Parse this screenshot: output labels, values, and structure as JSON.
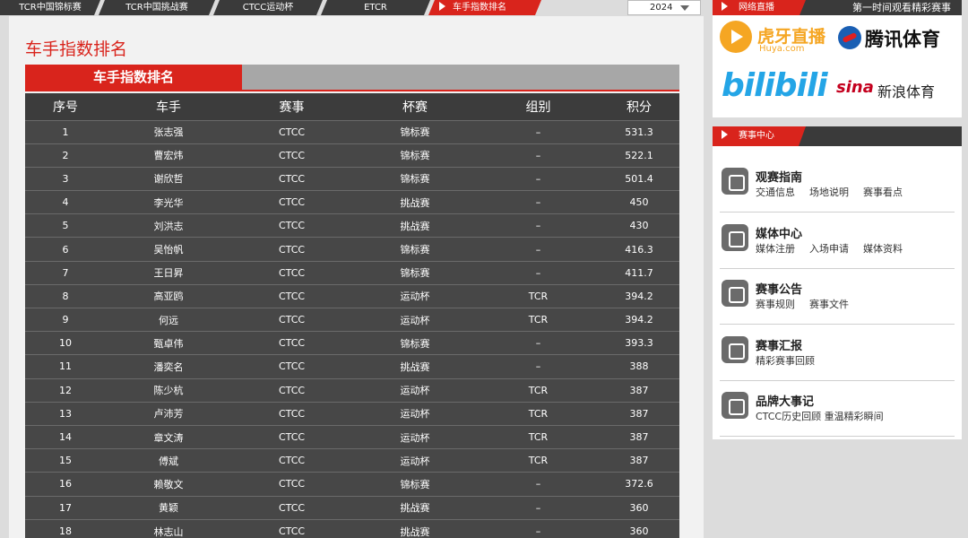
{
  "tabs": [
    {
      "label": "TCR中国锦标赛"
    },
    {
      "label": "TCR中国挑战赛"
    },
    {
      "label": "CTCC运动杯"
    },
    {
      "label": "ETCR"
    },
    {
      "label": "车手指数排名"
    }
  ],
  "year_select": {
    "value": "2024"
  },
  "page_title": "车手指数排名",
  "section_title": "车手指数排名",
  "table": {
    "headers": [
      "序号",
      "车手",
      "赛事",
      "杯赛",
      "组别",
      "积分"
    ],
    "rows": [
      [
        "1",
        "张志强",
        "CTCC",
        "锦标赛",
        "–",
        "531.3"
      ],
      [
        "2",
        "曹宏炜",
        "CTCC",
        "锦标赛",
        "–",
        "522.1"
      ],
      [
        "3",
        "谢欣哲",
        "CTCC",
        "锦标赛",
        "–",
        "501.4"
      ],
      [
        "4",
        "李光华",
        "CTCC",
        "挑战赛",
        "–",
        "450"
      ],
      [
        "5",
        "刘洪志",
        "CTCC",
        "挑战赛",
        "–",
        "430"
      ],
      [
        "6",
        "吴怡帆",
        "CTCC",
        "锦标赛",
        "–",
        "416.3"
      ],
      [
        "7",
        "王日昇",
        "CTCC",
        "锦标赛",
        "–",
        "411.7"
      ],
      [
        "8",
        "高亚鸥",
        "CTCC",
        "运动杯",
        "TCR",
        "394.2"
      ],
      [
        "9",
        "何远",
        "CTCC",
        "运动杯",
        "TCR",
        "394.2"
      ],
      [
        "10",
        "甄卓伟",
        "CTCC",
        "锦标赛",
        "–",
        "393.3"
      ],
      [
        "11",
        "潘奕名",
        "CTCC",
        "挑战赛",
        "–",
        "388"
      ],
      [
        "12",
        "陈少杭",
        "CTCC",
        "运动杯",
        "TCR",
        "387"
      ],
      [
        "13",
        "卢沛芳",
        "CTCC",
        "运动杯",
        "TCR",
        "387"
      ],
      [
        "14",
        "章文涛",
        "CTCC",
        "运动杯",
        "TCR",
        "387"
      ],
      [
        "15",
        "傅斌",
        "CTCC",
        "运动杯",
        "TCR",
        "387"
      ],
      [
        "16",
        "赖敬文",
        "CTCC",
        "锦标赛",
        "–",
        "372.6"
      ],
      [
        "17",
        "黄颖",
        "CTCC",
        "挑战赛",
        "–",
        "360"
      ],
      [
        "18",
        "林志山",
        "CTCC",
        "挑战赛",
        "–",
        "360"
      ]
    ]
  },
  "live": {
    "label": "网络直播",
    "note": "第一时间观看精彩赛事",
    "logos": {
      "huya": {
        "name": "虎牙直播",
        "sub": "Huya.com"
      },
      "tencent": {
        "name": "腾讯体育"
      },
      "bilibili": {
        "name": "bilibili"
      },
      "sina": {
        "brand": "sina",
        "name": "新浪体育"
      }
    }
  },
  "event_center": {
    "label": "赛事中心",
    "entries": [
      {
        "icon": "camera-icon",
        "title": "观赛指南",
        "links": [
          "交通信息",
          "场地说明",
          "赛事看点"
        ]
      },
      {
        "icon": "media-camera-icon",
        "title": "媒体中心",
        "links": [
          "媒体注册",
          "入场申请",
          "媒体资料"
        ]
      },
      {
        "icon": "document-icon",
        "title": "赛事公告",
        "links": [
          "赛事规则",
          "赛事文件"
        ]
      },
      {
        "icon": "monitor-icon",
        "title": "赛事汇报",
        "links": [
          "精彩赛事回顾"
        ]
      },
      {
        "icon": "lightbulb-icon",
        "title": "品牌大事记",
        "links": [
          "CTCC历史回顾 重温精彩瞬间"
        ]
      }
    ]
  },
  "colors": {
    "accent": "#d9241c",
    "table_bg": "#474747",
    "tab_bg": "#3a3a3a"
  }
}
